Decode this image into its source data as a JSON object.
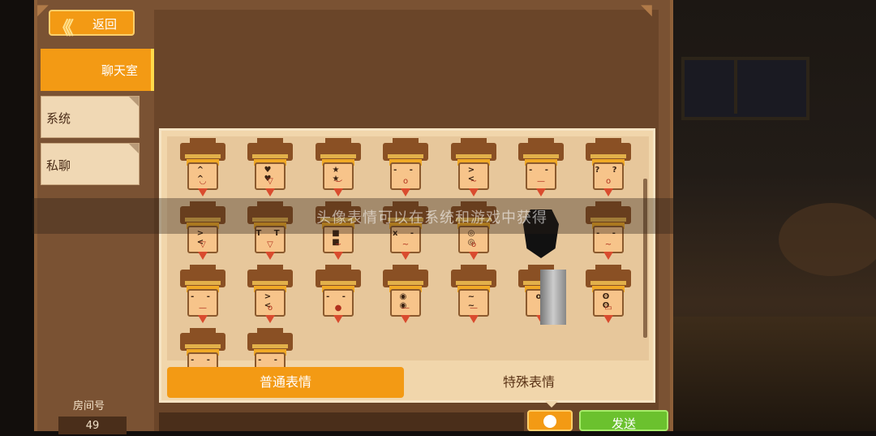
{
  "nav": {
    "back_label": "返回"
  },
  "sidebar": {
    "items": [
      {
        "label": "聊天室",
        "active": true
      },
      {
        "label": "系统",
        "active": false
      },
      {
        "label": "私聊",
        "active": false
      }
    ]
  },
  "room": {
    "label": "房间号",
    "number": "49"
  },
  "emoji_tabs": {
    "normal": "普通表情",
    "special": "特殊表情",
    "selected": "普通表情"
  },
  "send_label": "发送",
  "toast": "头像表情可以在系统和游戏中获得",
  "emojis": [
    {
      "eyes": "^ ^",
      "mouth": "◡"
    },
    {
      "eyes": "♥ ♥",
      "mouth": "▽"
    },
    {
      "eyes": "★ ★",
      "mouth": "︶"
    },
    {
      "eyes": "- -",
      "mouth": "o"
    },
    {
      "eyes": "> <",
      "mouth": "~"
    },
    {
      "eyes": "- -",
      "mouth": "—"
    },
    {
      "eyes": "? ?",
      "mouth": "o"
    },
    {
      "eyes": "> <",
      "mouth": "▽"
    },
    {
      "eyes": "T T",
      "mouth": "▽"
    },
    {
      "eyes": "■ ■",
      "mouth": "~"
    },
    {
      "eyes": "x -",
      "mouth": "~"
    },
    {
      "eyes": "◎ ◎",
      "mouth": "o"
    },
    {
      "eyes": "",
      "mouth": ""
    },
    {
      "eyes": "- -",
      "mouth": "~"
    },
    {
      "eyes": "- -",
      "mouth": "—"
    },
    {
      "eyes": "> <",
      "mouth": "o"
    },
    {
      "eyes": "- -",
      "mouth": "●"
    },
    {
      "eyes": "◉ ◉",
      "mouth": "—"
    },
    {
      "eyes": "~ ~",
      "mouth": "—"
    },
    {
      "eyes": "o",
      "mouth": ""
    },
    {
      "eyes": "ʘ ʘ",
      "mouth": "▭"
    },
    {
      "eyes": "- -",
      "mouth": ""
    },
    {
      "eyes": "- -",
      "mouth": ""
    }
  ]
}
